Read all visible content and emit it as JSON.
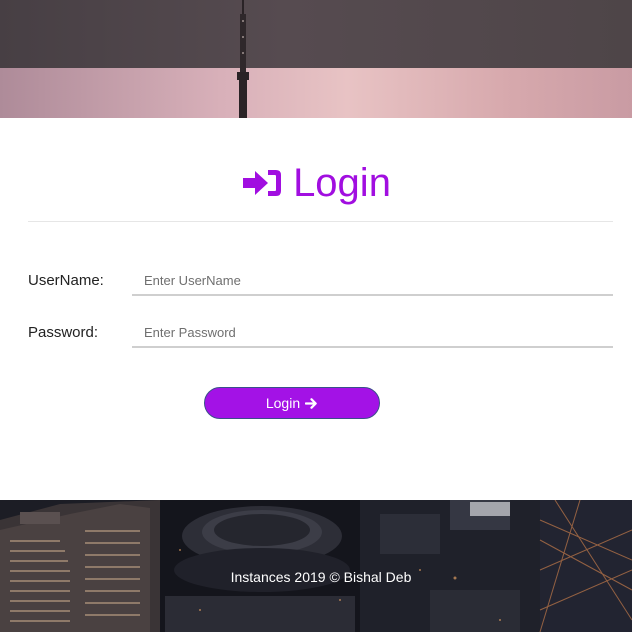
{
  "title": {
    "icon": "sign-in-icon",
    "text": "Login",
    "color": "#a10ee0"
  },
  "form": {
    "username": {
      "label": "UserName:",
      "placeholder": "Enter UserName",
      "value": ""
    },
    "password": {
      "label": "Password:",
      "placeholder": "Enter Password",
      "value": ""
    },
    "submit": {
      "label": "Login",
      "icon": "arrow-right-icon",
      "color": "#a312e6"
    }
  },
  "footer": {
    "text": "Instances 2019 © Bishal Deb"
  }
}
